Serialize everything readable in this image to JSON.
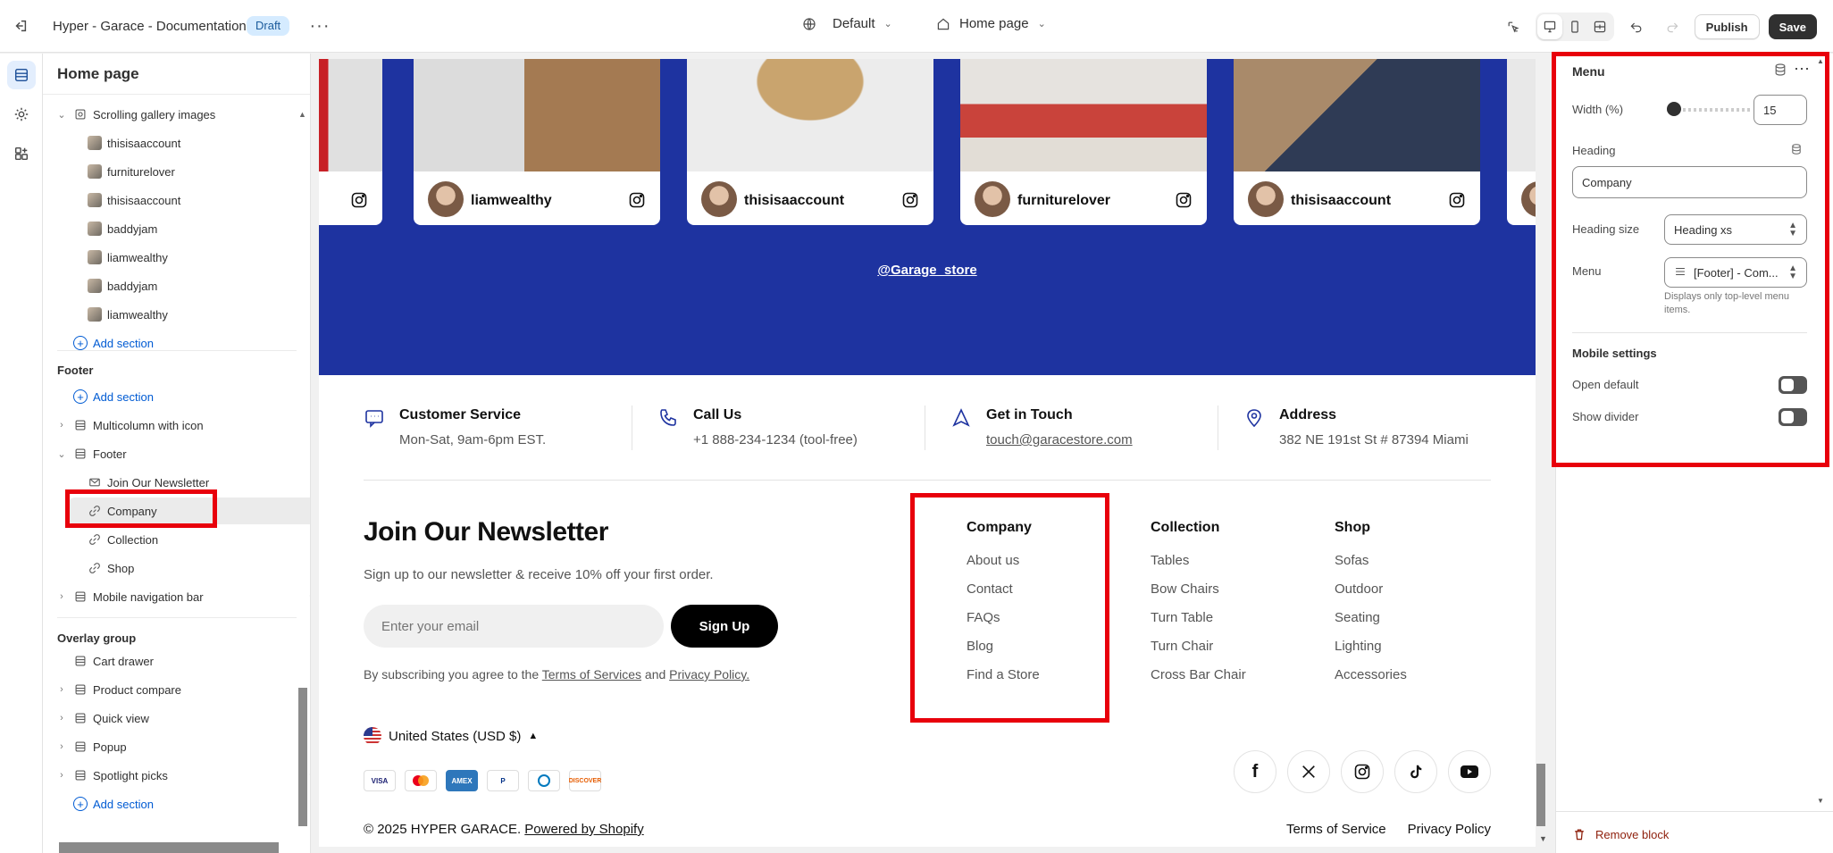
{
  "topbar": {
    "store_title": "Hyper - Garace - Documentation",
    "status_badge": "Draft",
    "theme_selector": "Default",
    "page_selector": "Home page",
    "publish_label": "Publish",
    "save_label": "Save"
  },
  "sidebar": {
    "title": "Home page",
    "gallery_group": "Scrolling gallery images",
    "gallery_items": [
      "thisisaaccount",
      "furniturelover",
      "thisisaaccount",
      "baddyjam",
      "liamwealthy",
      "baddyjam",
      "liamwealthy"
    ],
    "add_section": "Add section",
    "footer_heading": "Footer",
    "footer_sections": {
      "multicolumn": "Multicolumn with icon",
      "footer": "Footer",
      "blocks": [
        "Join Our Newsletter",
        "Company",
        "Collection",
        "Shop"
      ],
      "mobile_nav": "Mobile navigation bar"
    },
    "overlay_heading": "Overlay group",
    "overlay_items": [
      "Cart drawer",
      "Product compare",
      "Quick view",
      "Popup",
      "Spotlight picks"
    ]
  },
  "preview": {
    "gallery_cards": [
      "liamwealthy",
      "thisisaaccount",
      "furniturelover",
      "thisisaaccount"
    ],
    "handle": "@Garage_store",
    "info": [
      {
        "title": "Customer Service",
        "text": "Mon-Sat, 9am-6pm EST.",
        "icon": "chat-icon"
      },
      {
        "title": "Call Us",
        "text": "+1 888-234-1234 (tool-free)",
        "icon": "phone-icon"
      },
      {
        "title": "Get in Touch",
        "text": "touch@garacestore.com",
        "icon": "navigation-icon"
      },
      {
        "title": "Address",
        "text": "382 NE 191st St # 87394 Miami",
        "icon": "location-pin-icon"
      }
    ],
    "newsletter": {
      "title": "Join Our Newsletter",
      "subtitle": "Sign up to our newsletter & receive 10% off your first order.",
      "placeholder": "Enter your email",
      "button": "Sign Up",
      "legal_prefix": "By subscribing you agree to the",
      "terms": "Terms of Services",
      "and": "and",
      "privacy": "Privacy Policy."
    },
    "country": "United States (USD $)",
    "payments": [
      "VISA",
      "MC",
      "AMEX",
      "PayPal",
      "Diners",
      "DISCOVER"
    ],
    "menus": [
      {
        "heading": "Company",
        "links": [
          "About us",
          "Contact",
          "FAQs",
          "Blog",
          "Find a Store"
        ]
      },
      {
        "heading": "Collection",
        "links": [
          "Tables",
          "Bow Chairs",
          "Turn Table",
          "Turn Chair",
          "Cross Bar Chair"
        ]
      },
      {
        "heading": "Shop",
        "links": [
          "Sofas",
          "Outdoor",
          "Seating",
          "Lighting",
          "Accessories"
        ]
      }
    ],
    "copyright": "© 2025 HYPER GARACE.",
    "powered": "Powered by Shopify",
    "bottom_links": [
      "Terms of Service",
      "Privacy Policy"
    ]
  },
  "settings": {
    "title": "Menu",
    "width_label": "Width (%)",
    "width_value": "15",
    "width_fraction": 0.15,
    "heading_label": "Heading",
    "heading_value": "Company",
    "heading_size_label": "Heading size",
    "heading_size_value": "Heading xs",
    "menu_label": "Menu",
    "menu_value": "[Footer] - Com...",
    "menu_help": "Displays only top-level menu items.",
    "mobile_heading": "Mobile settings",
    "open_default": "Open default",
    "show_divider": "Show divider",
    "remove_block": "Remove block"
  },
  "colors": {
    "accent_blue": "#1e33a0",
    "highlight_red": "#e8000b",
    "save_bg": "#303030"
  }
}
